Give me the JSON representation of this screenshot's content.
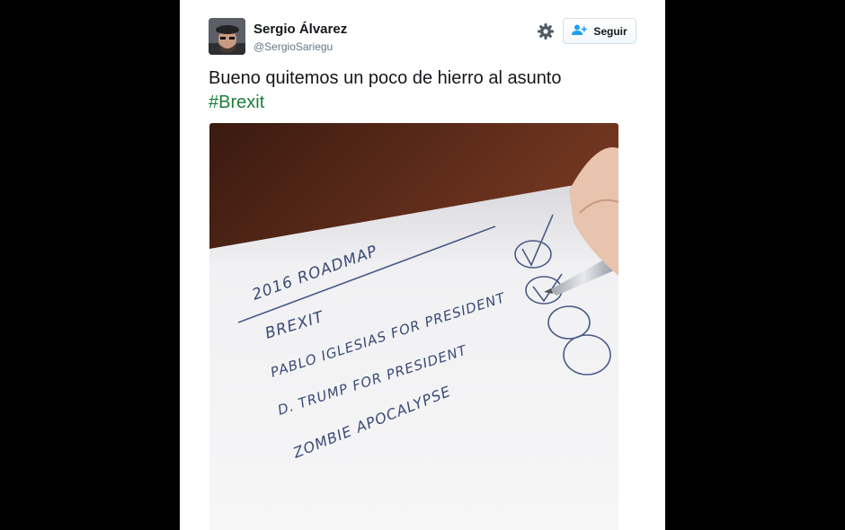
{
  "tweet": {
    "author": {
      "name": "Sergio Álvarez",
      "handle": "@SergioSariegu"
    },
    "follow_button": {
      "label": "Seguir",
      "icon": "add-user-icon"
    },
    "settings_icon": "gear-icon",
    "text": "Bueno quitemos un poco de hierro al asunto",
    "hashtag": "#Brexit"
  },
  "photo": {
    "handwriting": [
      "2016 ROADMAP",
      "BREXIT",
      "PABLO IGLESIAS FOR PRESIDENT",
      "D. TRUMP FOR PRESIDENT",
      "ZOMBIE APOCALYPSE"
    ],
    "checkmarks": [
      true,
      true,
      false,
      false
    ]
  },
  "colors": {
    "hashtag": "#1e7d3c",
    "background": "#000000",
    "card": "#ffffff"
  }
}
